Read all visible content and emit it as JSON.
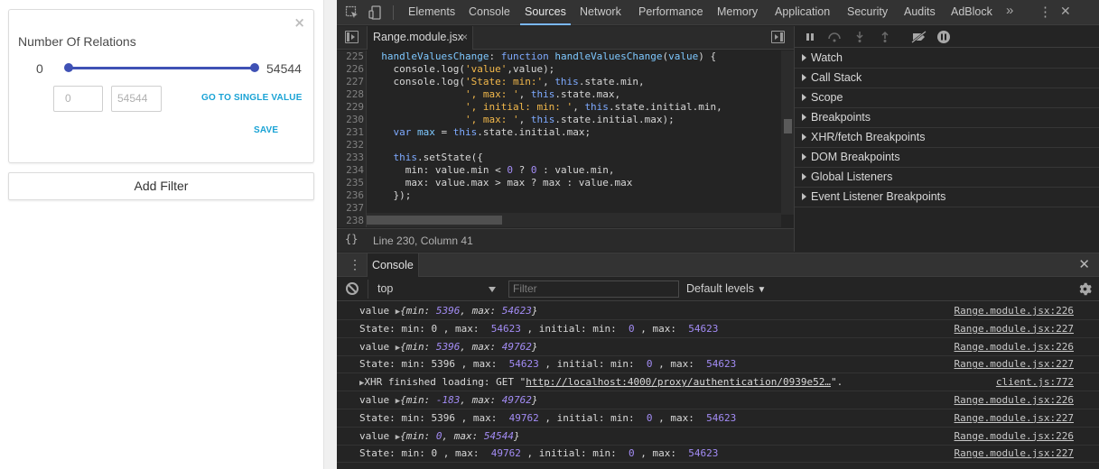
{
  "app": {
    "card": {
      "title": "Number Of Relations",
      "close_glyph": "×",
      "range_min": "0",
      "range_max": "54544",
      "input_min_placeholder": "0",
      "input_max_placeholder": "54544",
      "single_value_label": "GO TO SINGLE VALUE",
      "save_label": "SAVE"
    },
    "add_filter_label": "Add Filter"
  },
  "devtools": {
    "tabs": [
      "Elements",
      "Console",
      "Sources",
      "Network",
      "Performance",
      "Memory",
      "Application",
      "Security",
      "Audits",
      "AdBlock"
    ],
    "active_tab": "Sources",
    "more_tabs_glyph": "»",
    "menu_glyph": "⋮",
    "close_glyph": "✕",
    "sources": {
      "file_tab": "Range.module.jsx",
      "file_tab_close": "×",
      "code_lines": [
        {
          "n": "225",
          "html": "  <span class=\"f\">handleValuesChange</span>: <span class=\"k\">function</span> <span class=\"f\">handleValuesChange</span>(<span class=\"f\">value</span>) {"
        },
        {
          "n": "226",
          "html": "    console.log(<span class=\"s\">'value'</span>,value);"
        },
        {
          "n": "227",
          "html": "    console.log(<span class=\"s\">'State: min:'</span>, <span class=\"k\">this</span>.state.min,"
        },
        {
          "n": "228",
          "html": "                <span class=\"s\">', max: '</span>, <span class=\"k\">this</span>.state.max,"
        },
        {
          "n": "229",
          "html": "                <span class=\"s\">', initial: min: '</span>, <span class=\"k\">this</span>.state.initial.min,"
        },
        {
          "n": "230",
          "html": "                <span class=\"s\">', max: '</span>, <span class=\"k\">this</span>.state.initial.max);"
        },
        {
          "n": "231",
          "html": "    <span class=\"k\">var</span> <span class=\"f\">max</span> = <span class=\"k\">this</span>.state.initial.max;"
        },
        {
          "n": "232",
          "html": ""
        },
        {
          "n": "233",
          "html": "    <span class=\"k\">this</span>.setState({"
        },
        {
          "n": "234",
          "html": "      min: value.min &lt; <span class=\"m\">0</span> ? <span class=\"m\">0</span> : value.min,"
        },
        {
          "n": "235",
          "html": "      max: value.max &gt; max ? max : value.max"
        },
        {
          "n": "236",
          "html": "    });"
        },
        {
          "n": "237",
          "html": ""
        },
        {
          "n": "238",
          "html": ""
        }
      ],
      "status_pretty": "{}",
      "status_position": "Line 230, Column 41",
      "debug_sections": [
        "Watch",
        "Call Stack",
        "Scope",
        "Breakpoints",
        "XHR/fetch Breakpoints",
        "DOM Breakpoints",
        "Global Listeners",
        "Event Listener Breakpoints"
      ]
    },
    "console": {
      "drawer_tab": "Console",
      "context": "top",
      "filter_placeholder": "Filter",
      "levels": "Default levels",
      "levels_arrow": "▼",
      "messages": [
        {
          "html": "value <span class=\"tri\">▶</span><span class=\"obj\">{min: <span class=\"num\">5396</span>, max: <span class=\"num\">54623</span>}</span>",
          "src": "Range.module.jsx:226"
        },
        {
          "html": "State: min: 0 , max:  <span class=\"num\">54623</span> , initial: min:  <span class=\"num\">0</span> , max:  <span class=\"num\">54623</span>",
          "src": "Range.module.jsx:227"
        },
        {
          "html": "value <span class=\"tri\">▶</span><span class=\"obj\">{min: <span class=\"num\">5396</span>, max: <span class=\"num\">49762</span>}</span>",
          "src": "Range.module.jsx:226"
        },
        {
          "html": "State: min: 5396 , max:  <span class=\"num\">54623</span> , initial: min:  <span class=\"num\">0</span> , max:  <span class=\"num\">54623</span>",
          "src": "Range.module.jsx:227"
        },
        {
          "html": "<span class=\"tri\">▶</span>XHR finished loading: GET \"<span class=\"url\">http://localhost:4000/proxy/authentication/0939e52…</span>\".",
          "src": "client.js:772"
        },
        {
          "html": "value <span class=\"tri\">▶</span><span class=\"obj\">{min: <span class=\"num\">-183</span>, max: <span class=\"num\">49762</span>}</span>",
          "src": "Range.module.jsx:226"
        },
        {
          "html": "State: min: 5396 , max:  <span class=\"num\">49762</span> , initial: min:  <span class=\"num\">0</span> , max:  <span class=\"num\">54623</span>",
          "src": "Range.module.jsx:227"
        },
        {
          "html": "value <span class=\"tri\">▶</span><span class=\"obj\">{min: <span class=\"num\">0</span>, max: <span class=\"num\">54544</span>}</span>",
          "src": "Range.module.jsx:226"
        },
        {
          "html": "State: min: 0 , max:  <span class=\"num\">49762</span> , initial: min:  <span class=\"num\">0</span> , max:  <span class=\"num\">54623</span>",
          "src": "Range.module.jsx:227"
        }
      ]
    }
  }
}
